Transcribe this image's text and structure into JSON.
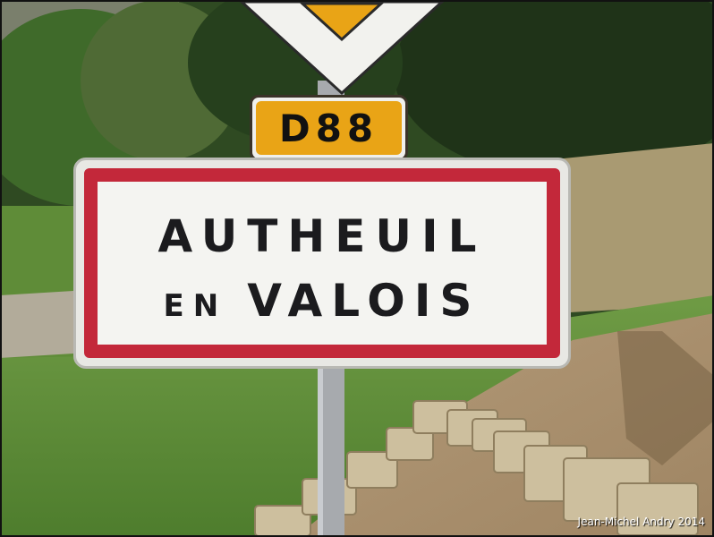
{
  "photo": {
    "road_number": "D88",
    "town_line_1": "AUTHEUIL",
    "town_line_2_prefix": "EN",
    "town_line_2_main": "VALOIS",
    "credit": "Jean-Michel Andry 2014"
  },
  "colors": {
    "sign_red": "#c3283a",
    "road_sign_yellow": "#e9a416",
    "sign_white": "#f4f4f1",
    "vegetation": "#3d6b2a"
  }
}
